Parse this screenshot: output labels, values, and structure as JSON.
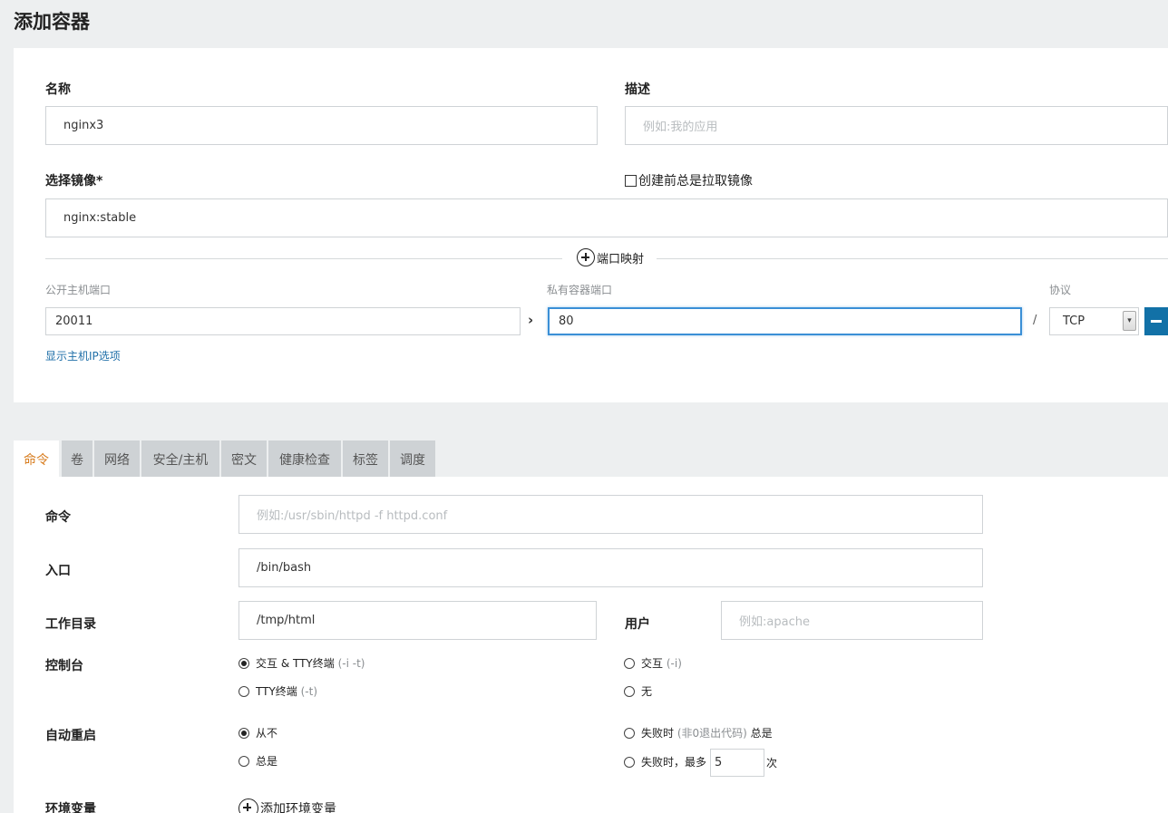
{
  "page_title": "添加容器",
  "basic": {
    "name_label": "名称",
    "name_value": "nginx3",
    "desc_label": "描述",
    "desc_placeholder": "例如:我的应用",
    "image_label": "选择镜像*",
    "pull_label": "创建前总是拉取镜像",
    "image_value": "nginx:stable"
  },
  "ports": {
    "add_label": "端口映射",
    "public_label": "公开主机端口",
    "private_label": "私有容器端口",
    "protocol_label": "协议",
    "public_value": "20011",
    "private_value": "80",
    "separator": "/",
    "protocol_value": "TCP",
    "show_ip_link": "显示主机IP选项"
  },
  "tabs": [
    {
      "label": "命令"
    },
    {
      "label": "卷"
    },
    {
      "label": "网络"
    },
    {
      "label": "安全/主机"
    },
    {
      "label": "密文"
    },
    {
      "label": "健康检查"
    },
    {
      "label": "标签"
    },
    {
      "label": "调度"
    }
  ],
  "command": {
    "cmd_label": "命令",
    "cmd_placeholder": "例如:/usr/sbin/httpd -f httpd.conf",
    "entry_label": "入口",
    "entry_value": "/bin/bash",
    "workdir_label": "工作目录",
    "workdir_value": "/tmp/html",
    "user_label": "用户",
    "user_placeholder": "例如:apache",
    "console_label": "控制台",
    "console_opt1": "交互 & TTY终端",
    "console_opt1_hint": "(-i -t)",
    "console_opt2": "交互",
    "console_opt2_hint": "(-i)",
    "console_opt3": "TTY终端",
    "console_opt3_hint": "(-t)",
    "console_opt4": "无",
    "restart_label": "自动重启",
    "restart_opt1": "从不",
    "restart_opt2": "失败时",
    "restart_opt2_hint": "(非0退出代码)",
    "restart_opt2_tail": "总是",
    "restart_opt3": "总是",
    "restart_opt4": "失败时，最多",
    "restart_max_value": "5",
    "restart_opt4_tail": "次",
    "env_label": "环境变量",
    "env_add": "添加环境变量"
  }
}
